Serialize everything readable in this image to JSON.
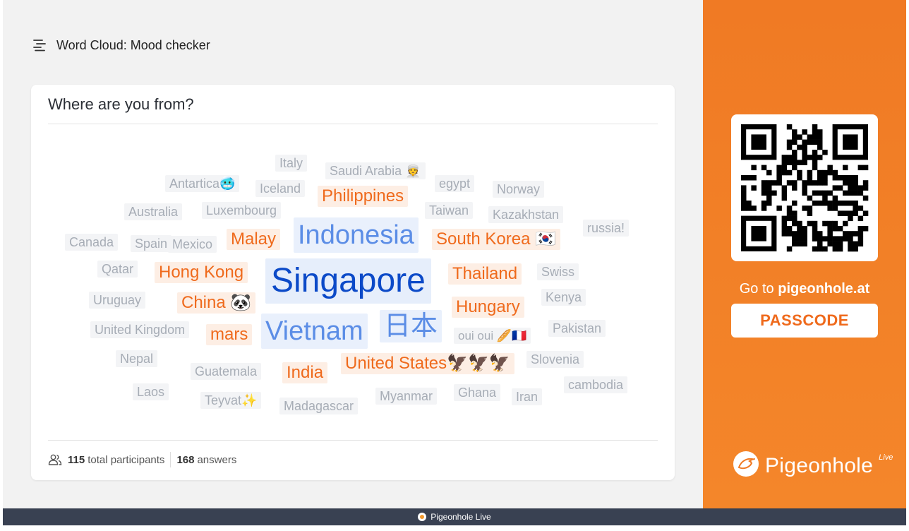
{
  "header": {
    "title": "Word Cloud: Mood checker",
    "icon": "word-cloud-icon"
  },
  "card": {
    "question": "Where are you from?",
    "stats": {
      "participants_count": "115",
      "participants_label": "total participants",
      "answers_count": "168",
      "answers_label": "answers"
    }
  },
  "words": [
    {
      "text": "Singapore",
      "tier": "big"
    },
    {
      "text": "Indonesia",
      "tier": "blue"
    },
    {
      "text": "Vietnam",
      "tier": "blue"
    },
    {
      "text": "日本",
      "tier": "blue"
    },
    {
      "text": "Philippines",
      "tier": "orange"
    },
    {
      "text": "Malay",
      "tier": "orange"
    },
    {
      "text": "South Korea 🇰🇷",
      "tier": "orange"
    },
    {
      "text": "Hong Kong",
      "tier": "orange"
    },
    {
      "text": "Thailand",
      "tier": "orange"
    },
    {
      "text": "China 🐼",
      "tier": "orange"
    },
    {
      "text": "Hungary",
      "tier": "orange"
    },
    {
      "text": "mars",
      "tier": "orange"
    },
    {
      "text": "India",
      "tier": "orange"
    },
    {
      "text": "United States🦅🦅🦅",
      "tier": "orange"
    },
    {
      "text": "Italy",
      "tier": "grey"
    },
    {
      "text": "Saudi Arabia 👳",
      "tier": "grey"
    },
    {
      "text": "Antartica🥶",
      "tier": "grey"
    },
    {
      "text": "Iceland",
      "tier": "grey"
    },
    {
      "text": "egypt",
      "tier": "grey"
    },
    {
      "text": "Norway",
      "tier": "grey"
    },
    {
      "text": "Australia",
      "tier": "grey"
    },
    {
      "text": "Luxembourg",
      "tier": "grey"
    },
    {
      "text": "Taiwan",
      "tier": "grey"
    },
    {
      "text": "Kazakhstan",
      "tier": "grey"
    },
    {
      "text": "russia!",
      "tier": "grey"
    },
    {
      "text": "Canada",
      "tier": "grey"
    },
    {
      "text": "Spain",
      "tier": "grey"
    },
    {
      "text": "Mexico",
      "tier": "grey"
    },
    {
      "text": "Qatar",
      "tier": "grey"
    },
    {
      "text": "Swiss",
      "tier": "grey"
    },
    {
      "text": "Uruguay",
      "tier": "grey"
    },
    {
      "text": "Kenya",
      "tier": "grey"
    },
    {
      "text": "United Kingdom",
      "tier": "grey"
    },
    {
      "text": "oui oui 🥖🇫🇷",
      "tier": "grey"
    },
    {
      "text": "Pakistan",
      "tier": "grey"
    },
    {
      "text": "Nepal",
      "tier": "grey"
    },
    {
      "text": "Guatemala",
      "tier": "grey"
    },
    {
      "text": "Slovenia",
      "tier": "grey"
    },
    {
      "text": "Laos",
      "tier": "grey"
    },
    {
      "text": "Teyvat✨",
      "tier": "grey"
    },
    {
      "text": "Madagascar",
      "tier": "grey"
    },
    {
      "text": "Myanmar",
      "tier": "grey"
    },
    {
      "text": "Ghana",
      "tier": "grey"
    },
    {
      "text": "Iran",
      "tier": "grey"
    },
    {
      "text": "cambodia",
      "tier": "grey"
    }
  ],
  "side": {
    "goto_prefix": "Go to ",
    "goto_url": "pigeonhole.at",
    "passcode": "PASSCODE",
    "brand_name": "Pigeonhole",
    "brand_live": "Live"
  },
  "footer": {
    "text": "Pigeonhole Live"
  },
  "colors": {
    "accent": "#F07A24",
    "word_orange": "#EF6A1C",
    "word_blue": "#5B8DE6",
    "word_big": "#0C4AC8",
    "word_grey": "#A7ADB6",
    "footer_bg": "#394152"
  }
}
